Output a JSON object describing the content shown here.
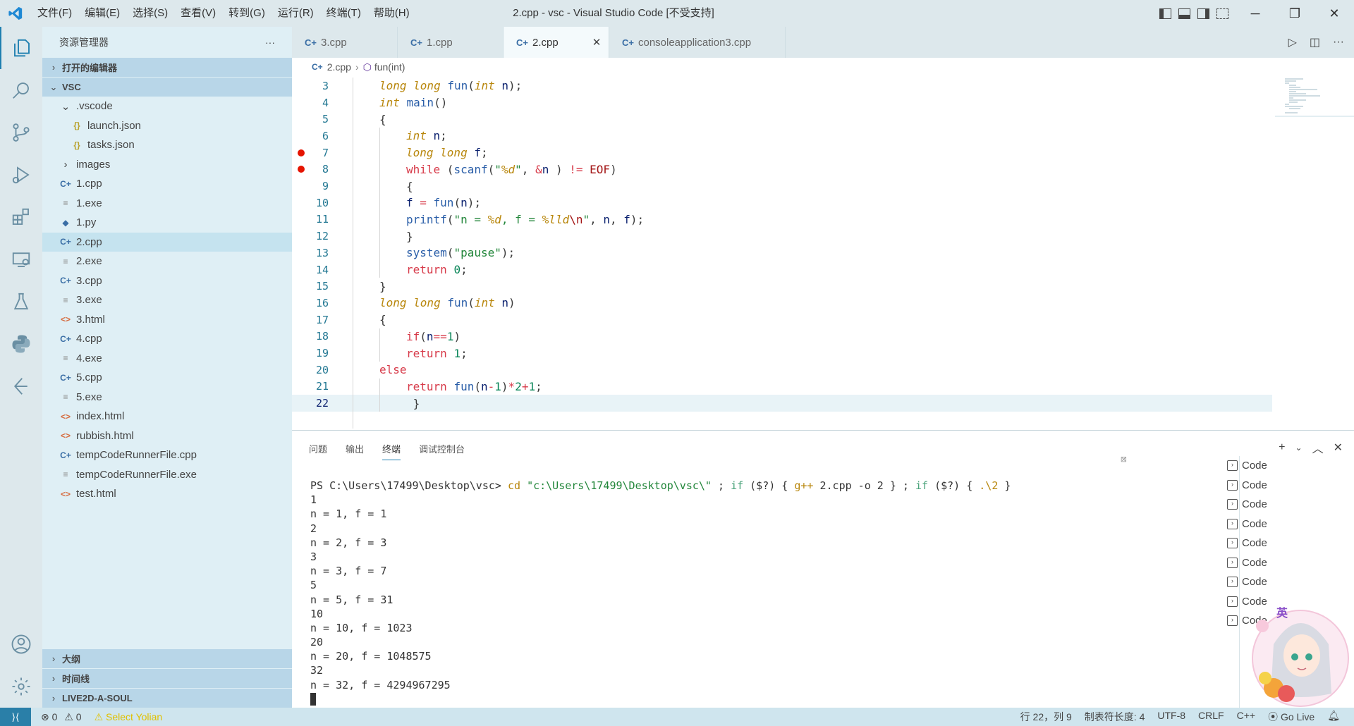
{
  "window": {
    "menus": [
      "文件(F)",
      "编辑(E)",
      "选择(S)",
      "查看(V)",
      "转到(G)",
      "运行(R)",
      "终端(T)",
      "帮助(H)"
    ],
    "title": "2.cpp - vsc - Visual Studio Code [不受支持]"
  },
  "sidebar": {
    "header": "资源管理器",
    "more": "···",
    "open_editors": "打开的编辑器",
    "folder": "VSC",
    "tree": [
      {
        "label": ".vscode",
        "type": "folder",
        "indent": 1,
        "open": true
      },
      {
        "label": "launch.json",
        "type": "json",
        "indent": 2
      },
      {
        "label": "tasks.json",
        "type": "json",
        "indent": 2
      },
      {
        "label": "images",
        "type": "folder",
        "indent": 1,
        "open": false
      },
      {
        "label": "1.cpp",
        "type": "cpp",
        "indent": 1
      },
      {
        "label": "1.exe",
        "type": "exe",
        "indent": 1
      },
      {
        "label": "1.py",
        "type": "py",
        "indent": 1
      },
      {
        "label": "2.cpp",
        "type": "cpp",
        "indent": 1,
        "selected": true
      },
      {
        "label": "2.exe",
        "type": "exe",
        "indent": 1
      },
      {
        "label": "3.cpp",
        "type": "cpp",
        "indent": 1
      },
      {
        "label": "3.exe",
        "type": "exe",
        "indent": 1
      },
      {
        "label": "3.html",
        "type": "html",
        "indent": 1
      },
      {
        "label": "4.cpp",
        "type": "cpp",
        "indent": 1
      },
      {
        "label": "4.exe",
        "type": "exe",
        "indent": 1
      },
      {
        "label": "5.cpp",
        "type": "cpp",
        "indent": 1
      },
      {
        "label": "5.exe",
        "type": "exe",
        "indent": 1
      },
      {
        "label": "index.html",
        "type": "html",
        "indent": 1
      },
      {
        "label": "rubbish.html",
        "type": "html",
        "indent": 1
      },
      {
        "label": "tempCodeRunnerFile.cpp",
        "type": "cpp",
        "indent": 1
      },
      {
        "label": "tempCodeRunnerFile.exe",
        "type": "exe",
        "indent": 1
      },
      {
        "label": "test.html",
        "type": "html",
        "indent": 1
      }
    ],
    "bottom_sections": [
      "大纲",
      "时间线",
      "LIVE2D-A-SOUL"
    ]
  },
  "tabs": [
    {
      "label": "3.cpp",
      "active": false
    },
    {
      "label": "1.cpp",
      "active": false
    },
    {
      "label": "2.cpp",
      "active": true
    },
    {
      "label": "consoleapplication3.cpp",
      "active": false
    }
  ],
  "breadcrumb": {
    "file": "2.cpp",
    "symbol": "fun(int)"
  },
  "editor": {
    "current_line": 22,
    "breakpoints": [
      7,
      8
    ],
    "lines": [
      {
        "n": 3,
        "indent": 1,
        "tokens": [
          [
            "kw",
            "long long "
          ],
          [
            "fn",
            "fun"
          ],
          [
            "",
            "("
          ],
          [
            "kw",
            "int "
          ],
          [
            "vr",
            "n"
          ],
          [
            "",
            ");"
          ]
        ]
      },
      {
        "n": 4,
        "indent": 1,
        "tokens": [
          [
            "kw",
            "int "
          ],
          [
            "fn",
            "main"
          ],
          [
            "",
            "()"
          ]
        ]
      },
      {
        "n": 5,
        "indent": 1,
        "tokens": [
          [
            "",
            "{"
          ]
        ]
      },
      {
        "n": 6,
        "indent": 2,
        "tokens": [
          [
            "kw",
            "int "
          ],
          [
            "vr",
            "n"
          ],
          [
            "",
            ";"
          ]
        ]
      },
      {
        "n": 7,
        "indent": 2,
        "tokens": [
          [
            "kw",
            "long long "
          ],
          [
            "vr",
            "f"
          ],
          [
            "",
            ";"
          ]
        ]
      },
      {
        "n": 8,
        "indent": 2,
        "tokens": [
          [
            "ctl",
            "while "
          ],
          [
            "",
            "("
          ],
          [
            "fn",
            "scanf"
          ],
          [
            "",
            "("
          ],
          [
            "str",
            "\""
          ],
          [
            "fmt",
            "%d"
          ],
          [
            "str",
            "\""
          ],
          [
            "",
            ", "
          ],
          [
            "op",
            "&"
          ],
          [
            "vr",
            "n"
          ],
          [
            "",
            " ) "
          ],
          [
            "op",
            "!= "
          ],
          [
            "mac",
            "EOF"
          ],
          [
            "",
            ")"
          ]
        ]
      },
      {
        "n": 9,
        "indent": 2,
        "tokens": [
          [
            "",
            "{"
          ]
        ]
      },
      {
        "n": 10,
        "indent": 2,
        "tokens": [
          [
            "vr",
            "f "
          ],
          [
            "op",
            "= "
          ],
          [
            "fn",
            "fun"
          ],
          [
            "",
            "("
          ],
          [
            "vr",
            "n"
          ],
          [
            "",
            ");"
          ]
        ]
      },
      {
        "n": 11,
        "indent": 2,
        "tokens": [
          [
            "fn",
            "printf"
          ],
          [
            "",
            "("
          ],
          [
            "str",
            "\"n = "
          ],
          [
            "fmt",
            "%d"
          ],
          [
            "str",
            ", f = "
          ],
          [
            "fmt",
            "%lld"
          ],
          [
            "mac",
            "\\n"
          ],
          [
            "str",
            "\""
          ],
          [
            "",
            ", "
          ],
          [
            "vr",
            "n"
          ],
          [
            "",
            ", "
          ],
          [
            "vr",
            "f"
          ],
          [
            "",
            ");"
          ]
        ]
      },
      {
        "n": 12,
        "indent": 2,
        "tokens": [
          [
            "",
            "}"
          ]
        ]
      },
      {
        "n": 13,
        "indent": 2,
        "tokens": [
          [
            "fn",
            "system"
          ],
          [
            "",
            "("
          ],
          [
            "str",
            "\"pause\""
          ],
          [
            "",
            ");"
          ]
        ]
      },
      {
        "n": 14,
        "indent": 2,
        "tokens": [
          [
            "ctl",
            "return "
          ],
          [
            "num",
            "0"
          ],
          [
            "",
            ";"
          ]
        ]
      },
      {
        "n": 15,
        "indent": 1,
        "tokens": [
          [
            "",
            "}"
          ]
        ]
      },
      {
        "n": 16,
        "indent": 1,
        "tokens": [
          [
            "kw",
            "long long "
          ],
          [
            "fn",
            "fun"
          ],
          [
            "",
            "("
          ],
          [
            "kw",
            "int "
          ],
          [
            "vr",
            "n"
          ],
          [
            "",
            ")"
          ]
        ]
      },
      {
        "n": 17,
        "indent": 1,
        "tokens": [
          [
            "",
            "{"
          ]
        ]
      },
      {
        "n": 18,
        "indent": 2,
        "tokens": [
          [
            "ctl",
            "if"
          ],
          [
            "",
            "("
          ],
          [
            "vr",
            "n"
          ],
          [
            "op",
            "=="
          ],
          [
            "num",
            "1"
          ],
          [
            "",
            ")"
          ]
        ]
      },
      {
        "n": 19,
        "indent": 2,
        "tokens": [
          [
            "ctl",
            "return "
          ],
          [
            "num",
            "1"
          ],
          [
            "",
            ";"
          ]
        ]
      },
      {
        "n": 20,
        "indent": 1,
        "tokens": [
          [
            "ctl",
            "else"
          ]
        ]
      },
      {
        "n": 21,
        "indent": 2,
        "tokens": [
          [
            "ctl",
            "return "
          ],
          [
            "fn",
            "fun"
          ],
          [
            "",
            "("
          ],
          [
            "vr",
            "n"
          ],
          [
            "op",
            "-"
          ],
          [
            "num",
            "1"
          ],
          [
            "",
            ")"
          ],
          [
            "op",
            "*"
          ],
          [
            "num",
            "2"
          ],
          [
            "op",
            "+"
          ],
          [
            "num",
            "1"
          ],
          [
            "",
            ";"
          ]
        ]
      },
      {
        "n": 22,
        "indent": 2,
        "tokens": [
          [
            "",
            " }"
          ]
        ]
      }
    ]
  },
  "panel": {
    "tabs": [
      "问题",
      "输出",
      "终端",
      "调试控制台"
    ],
    "active_tab": "终端",
    "terminal_lines": [
      [
        [
          "",
          "PS C:\\Users\\17499\\Desktop\\vsc> "
        ],
        [
          "t-cmd",
          "cd "
        ],
        [
          "t-str",
          "\"c:\\Users\\17499\\Desktop\\vsc\\\""
        ],
        [
          "",
          " ; "
        ],
        [
          "t-kw",
          "if "
        ],
        [
          "",
          "($?) { "
        ],
        [
          "t-cmd",
          "g++ "
        ],
        [
          "",
          "2.cpp -o 2 } ; "
        ],
        [
          "t-kw",
          "if "
        ],
        [
          "",
          "($?) { "
        ],
        [
          "t-cmd",
          ".\\2"
        ],
        [
          "",
          " }"
        ]
      ],
      [
        [
          "",
          "1"
        ]
      ],
      [
        [
          "",
          "n = 1, f = 1"
        ]
      ],
      [
        [
          "",
          "2"
        ]
      ],
      [
        [
          "",
          "n = 2, f = 3"
        ]
      ],
      [
        [
          "",
          "3"
        ]
      ],
      [
        [
          "",
          "n = 3, f = 7"
        ]
      ],
      [
        [
          "",
          "5"
        ]
      ],
      [
        [
          "",
          "n = 5, f = 31"
        ]
      ],
      [
        [
          "",
          "10"
        ]
      ],
      [
        [
          "",
          "n = 10, f = 1023"
        ]
      ],
      [
        [
          "",
          "20"
        ]
      ],
      [
        [
          "",
          "n = 20, f = 1048575"
        ]
      ],
      [
        [
          "",
          "32"
        ]
      ],
      [
        [
          "",
          "n = 32, f = 4294967295"
        ]
      ]
    ],
    "terminal_list": [
      "Code",
      "Code",
      "Code",
      "Code",
      "Code",
      "Code",
      "Code",
      "Code",
      "Code"
    ],
    "avatar_badge": "英"
  },
  "status": {
    "errors": "0",
    "warnings": "0",
    "selected_user": "Select Yolian",
    "position": "行 22，列 9",
    "tab_size": "制表符长度: 4",
    "encoding": "UTF-8",
    "eol": "CRLF",
    "language": "C++",
    "go_live": "Go Live"
  }
}
